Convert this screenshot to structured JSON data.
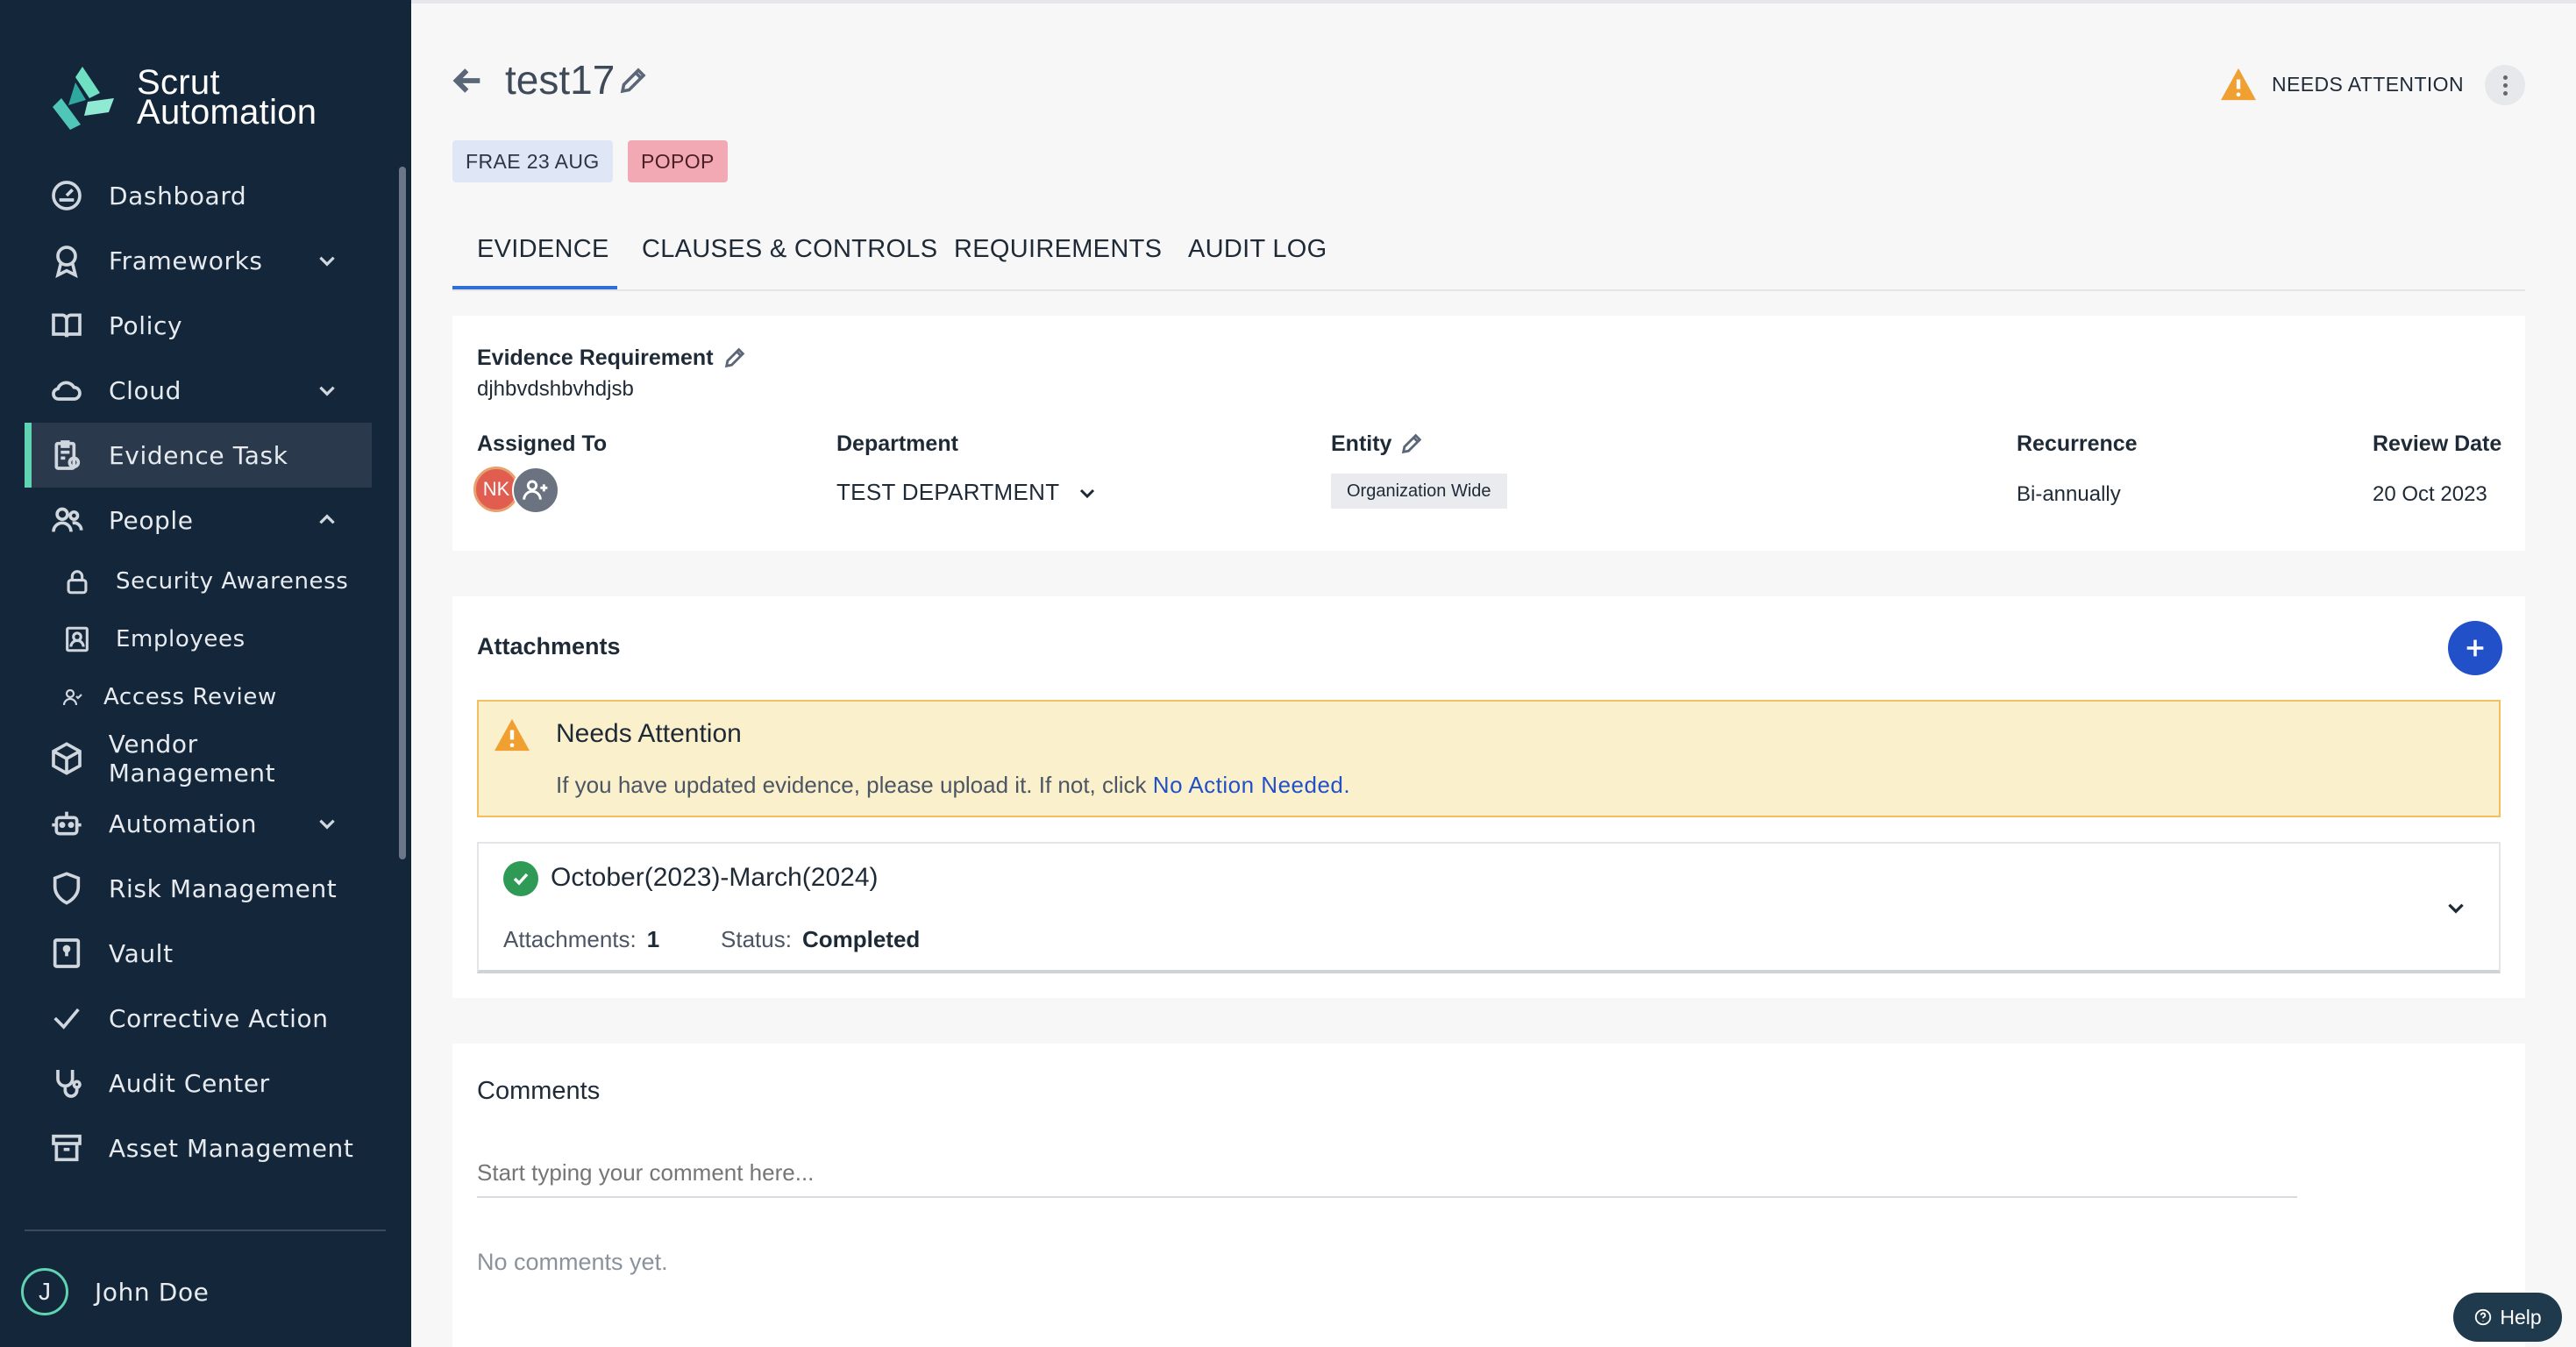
{
  "app": {
    "logo_line1": "Scrut",
    "logo_line2": "Automation"
  },
  "sidebar": {
    "items": [
      {
        "label": "Dashboard",
        "icon": "dashboard-icon"
      },
      {
        "label": "Frameworks",
        "icon": "award-icon",
        "chevron": "down"
      },
      {
        "label": "Policy",
        "icon": "book-icon"
      },
      {
        "label": "Cloud",
        "icon": "cloud-icon",
        "chevron": "down"
      },
      {
        "label": "Evidence Task",
        "icon": "clipboard-icon",
        "active": true
      },
      {
        "label": "People",
        "icon": "people-icon",
        "chevron": "up"
      },
      {
        "label": "Security Awareness",
        "icon": "lock-icon"
      },
      {
        "label": "Employees",
        "icon": "employee-badge-icon"
      },
      {
        "label": "Access Review",
        "icon": "user-check-icon"
      },
      {
        "label": "Vendor Management",
        "icon": "box-icon"
      },
      {
        "label": "Automation",
        "icon": "robot-icon",
        "chevron": "down"
      },
      {
        "label": "Risk Management",
        "icon": "shield-icon"
      },
      {
        "label": "Vault",
        "icon": "vault-icon"
      },
      {
        "label": "Corrective Action",
        "icon": "check-icon"
      },
      {
        "label": "Audit Center",
        "icon": "stethoscope-icon"
      },
      {
        "label": "Asset Management",
        "icon": "archive-icon"
      }
    ],
    "user": {
      "initial": "J",
      "name": "John Doe"
    }
  },
  "header": {
    "title": "test17",
    "status": "NEEDS ATTENTION",
    "tags": [
      "FRAE 23 AUG",
      "POPOP"
    ]
  },
  "tabs": [
    "EVIDENCE",
    "CLAUSES & CONTROLS",
    "REQUIREMENTS",
    "AUDIT LOG"
  ],
  "details": {
    "evidence_requirement_label": "Evidence Requirement",
    "evidence_requirement_value": "djhbvdshbvhdjsb",
    "assigned_to_label": "Assigned To",
    "assignee_initials": "NK",
    "department_label": "Department",
    "department_value": "TEST DEPARTMENT",
    "entity_label": "Entity",
    "entity_value": "Organization Wide",
    "recurrence_label": "Recurrence",
    "recurrence_value": "Bi-annually",
    "review_date_label": "Review Date",
    "review_date_value": "20 Oct 2023"
  },
  "attachments": {
    "title": "Attachments",
    "alert_title": "Needs Attention",
    "alert_message": "If you have updated evidence, please upload it. If not, click",
    "alert_link": "No Action Needed.",
    "period_title": "October(2023)-March(2024)",
    "attachments_label": "Attachments:",
    "attachments_count": "1",
    "status_label": "Status:",
    "status_value": "Completed"
  },
  "comments": {
    "title": "Comments",
    "placeholder": "Start typing your comment here...",
    "empty": "No comments yet."
  },
  "help": {
    "label": "Help"
  },
  "colors": {
    "sidebar": "#14263a",
    "accent": "#5fd3b2",
    "primary": "#2150c8",
    "warning": "#f0a030",
    "success": "#2e9a55"
  }
}
